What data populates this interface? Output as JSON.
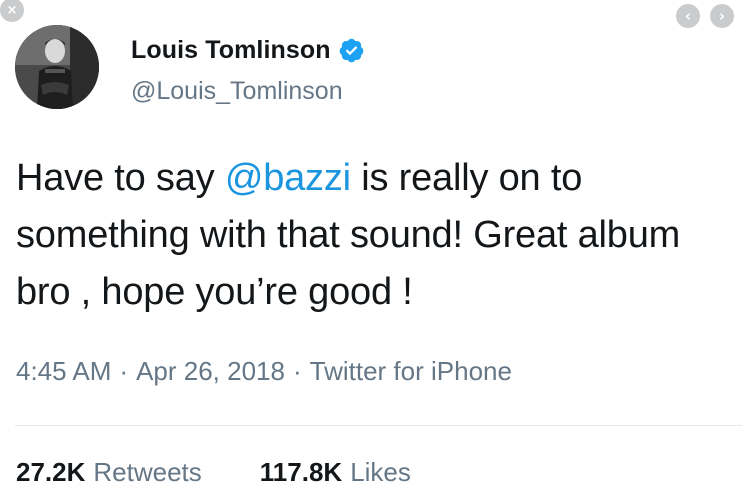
{
  "window": {
    "close_glyph": "×",
    "prev_glyph": "‹",
    "next_glyph": "›"
  },
  "author": {
    "display_name": "Louis Tomlinson",
    "handle": "@Louis_Tomlinson",
    "verified": true,
    "avatar_icon": "profile-photo"
  },
  "tweet": {
    "text_before": "Have to say ",
    "mention": "@bazzi",
    "text_after": " is really on to something with that sound! Great album bro , hope you’re good !"
  },
  "meta": {
    "time": "4:45 AM",
    "separator": "·",
    "date": "Apr 26, 2018",
    "source": "Twitter for iPhone"
  },
  "stats": {
    "retweets_count": "27.2K",
    "retweets_label": "Retweets",
    "likes_count": "117.8K",
    "likes_label": "Likes"
  },
  "colors": {
    "mention": "#1b95e0",
    "secondary_text": "#657786",
    "primary_text": "#14171a",
    "verified_badge": "#1da1f2"
  }
}
